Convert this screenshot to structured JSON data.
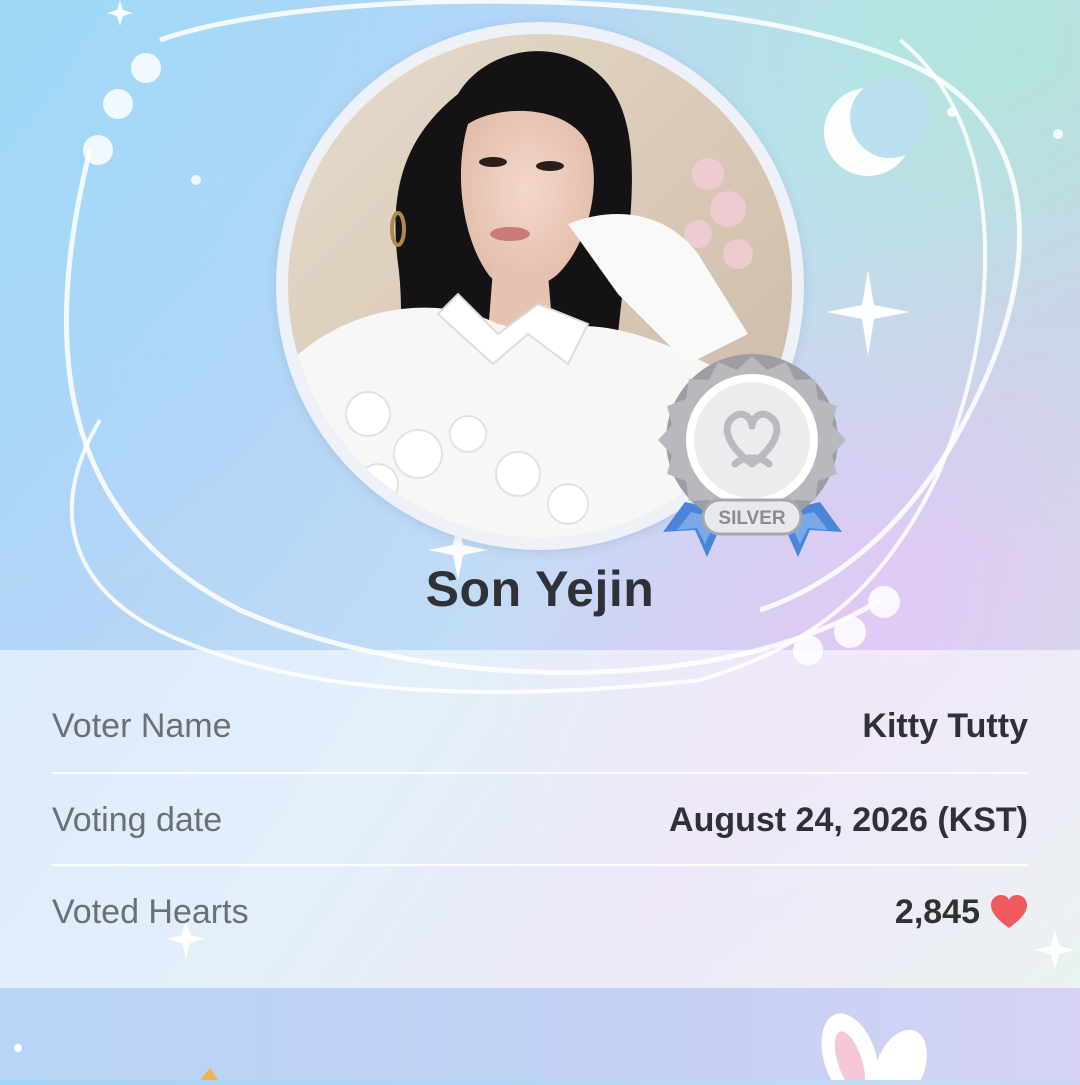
{
  "idol": {
    "name": "Son Yejin",
    "badge_label": "SILVER"
  },
  "vote_info": {
    "rows": [
      {
        "label": "Voter Name",
        "value": "Kitty Tutty"
      },
      {
        "label": "Voting date",
        "value": "August 24, 2026 (KST)"
      },
      {
        "label": "Voted Hearts",
        "value": "2,845"
      }
    ]
  },
  "icons": {
    "heart": "heart-icon",
    "medal": "silver-medal-icon",
    "moon": "crescent-moon-icon",
    "sparkle": "sparkle-icon",
    "bunny": "bunny-ears-icon"
  },
  "colors": {
    "heart": "#ef5a5f",
    "text_primary": "#303136",
    "text_secondary": "#6c6f76",
    "ribbon": "#4a86d8",
    "medal": "#c9cbd0"
  }
}
